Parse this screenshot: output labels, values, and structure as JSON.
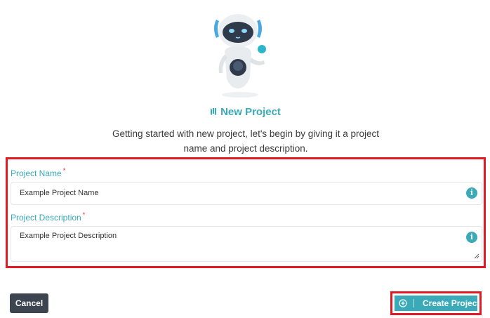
{
  "header": {
    "title": "New Project",
    "description_line1": "Getting started with new project, let's begin by giving it a project",
    "description_line2": "name and project description."
  },
  "form": {
    "project_name": {
      "label": "Project Name",
      "required_mark": "*",
      "value": "Example Project Name",
      "info_icon": "i"
    },
    "project_description": {
      "label": "Project Description",
      "required_mark": "*",
      "value": "Example Project Description",
      "info_icon": "i"
    }
  },
  "actions": {
    "cancel_label": "Cancel",
    "create_label": "Create Project"
  },
  "icons": {
    "title": "project-icon",
    "info": "info-icon",
    "create": "plus-circle-icon",
    "illustration": "robot-illustration"
  },
  "colors": {
    "accent": "#3aa9b8",
    "highlight": "#e01b24",
    "cancel_bg": "#3d4551"
  }
}
